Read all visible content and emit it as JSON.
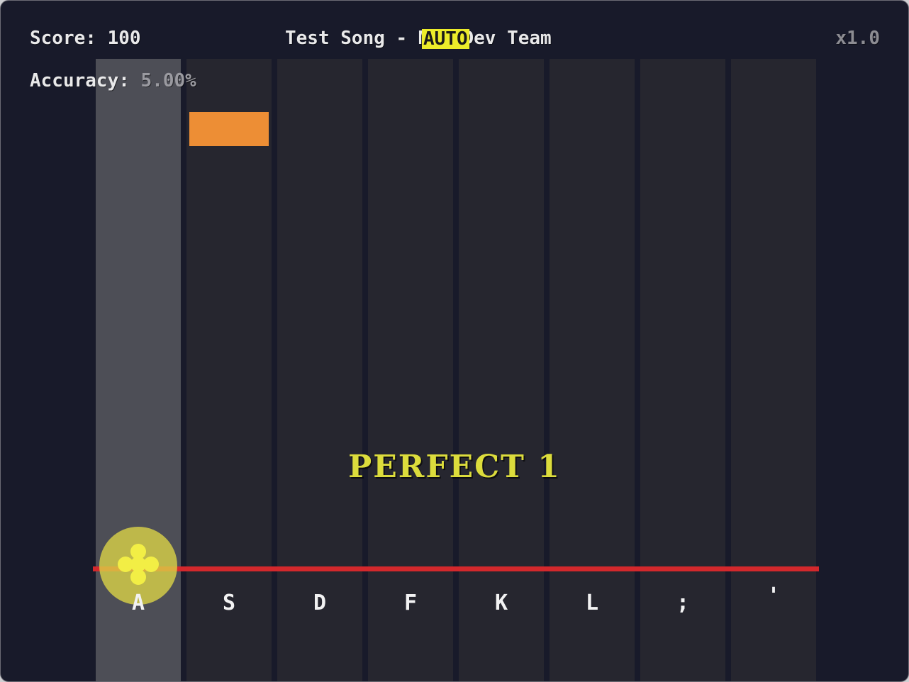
{
  "hud": {
    "score_label": "Score: 100",
    "accuracy_label": "Accuracy: ",
    "accuracy_value": "5.00%",
    "song_title": "Test Song - Meu Dev Team",
    "auto_badge": "AUTO",
    "speed": "x1.0"
  },
  "judgement": {
    "text": "PERFECT 1",
    "color": "#dcdc3c"
  },
  "lanes": {
    "count": 8,
    "keys": [
      "A",
      "S",
      "D",
      "F",
      "K",
      "L",
      ";",
      "'"
    ],
    "active_key": "A"
  },
  "colors": {
    "background": "#181a2a",
    "lane": "#26262f",
    "lane_active": "#4d4e56",
    "note": "#ed8e35",
    "hit_line": "#d3282c",
    "hit_effect": "#f2ee45"
  },
  "icons": {
    "hit_effect": "flower-burst-icon"
  }
}
